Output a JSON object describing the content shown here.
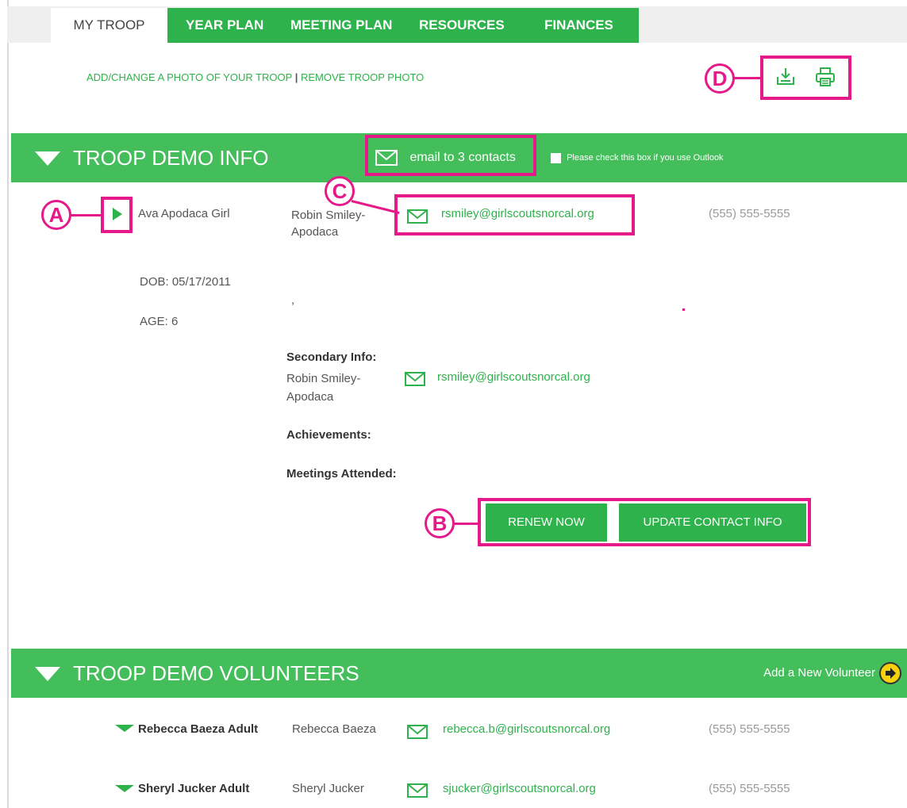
{
  "tabs": [
    {
      "label": "MY TROOP"
    },
    {
      "label": "YEAR PLAN"
    },
    {
      "label": "MEETING PLAN"
    },
    {
      "label": "RESOURCES"
    },
    {
      "label": "FINANCES"
    }
  ],
  "photo": {
    "add_label": "ADD/CHANGE A PHOTO OF YOUR TROOP",
    "separator": "|",
    "remove_label": "REMOVE TROOP PHOTO"
  },
  "annotations": {
    "a": "A",
    "b": "B",
    "c": "C",
    "d": "D"
  },
  "info_section": {
    "title": "TROOP DEMO INFO",
    "email_all_label": "email to 3 contacts",
    "outlook_label": "Please check this box if you use Outlook"
  },
  "girl": {
    "name": "Ava Apodaca Girl",
    "parent_line1": "Robin Smiley-",
    "parent_line2": "Apodaca",
    "email": "rsmiley@girlscoutsnorcal.org",
    "phone": "(555) 555-5555",
    "dob": "DOB: 05/17/2011",
    "age": "AGE: 6",
    "comma": ",",
    "secondary_heading": "Secondary Info:",
    "secondary_line1": "Robin Smiley-",
    "secondary_line2": "Apodaca",
    "secondary_email": "rsmiley@girlscoutsnorcal.org",
    "achievements_label": "Achievements:",
    "meetings_label": "Meetings Attended:"
  },
  "buttons": {
    "renew": "RENEW NOW",
    "update": "UPDATE CONTACT INFO"
  },
  "volunteers_section": {
    "title": "TROOP DEMO VOLUNTEERS",
    "add_label": "Add a New Volunteer"
  },
  "volunteers": [
    {
      "label": "Rebecca Baeza Adult",
      "name": "Rebecca Baeza",
      "email": "rebecca.b@girlscoutsnorcal.org",
      "phone": "(555) 555-5555"
    },
    {
      "label": "Sheryl Jucker Adult",
      "name": "Sheryl Jucker",
      "email": "sjucker@girlscoutsnorcal.org",
      "phone": "(555) 555-5555"
    }
  ],
  "icons": {
    "download": "download-icon",
    "print": "print-icon",
    "envelope": "envelope-icon",
    "expand": "triangle-down-icon",
    "arrow": "arrow-circle-icon"
  },
  "colors": {
    "brand_green": "#2eb24b",
    "section_green": "#44bd5b",
    "annotation_pink": "#e5198a",
    "arrow_yellow": "#f5d20a"
  }
}
